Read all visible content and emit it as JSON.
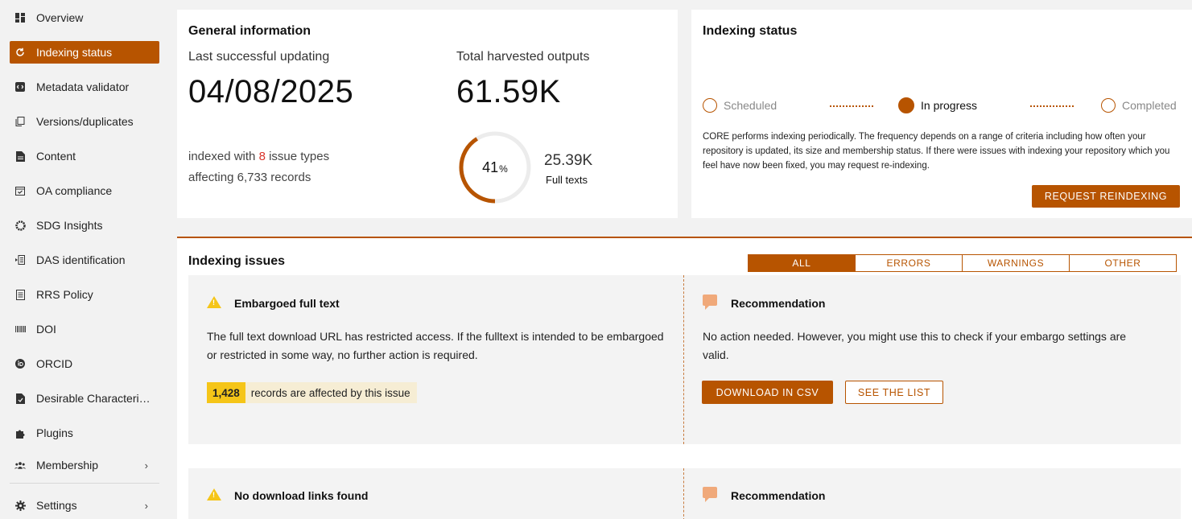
{
  "sidebar": {
    "items": [
      {
        "label": "Overview",
        "icon": "dashboard-icon"
      },
      {
        "label": "Indexing status",
        "icon": "sync-icon",
        "active": true
      },
      {
        "label": "Metadata validator",
        "icon": "code-icon"
      },
      {
        "label": "Versions/duplicates",
        "icon": "copy-icon"
      },
      {
        "label": "Content",
        "icon": "file-icon"
      },
      {
        "label": "OA compliance",
        "icon": "checkbox-icon"
      },
      {
        "label": "SDG Insights",
        "icon": "sdg-wheel-icon"
      },
      {
        "label": "DAS identification",
        "icon": "das-icon"
      },
      {
        "label": "RRS Policy",
        "icon": "policy-icon"
      },
      {
        "label": "DOI",
        "icon": "barcode-icon"
      },
      {
        "label": "ORCID",
        "icon": "orcid-icon"
      },
      {
        "label": "Desirable Characteri…",
        "icon": "document-icon"
      },
      {
        "label": "Plugins",
        "icon": "puzzle-icon"
      },
      {
        "label": "Membership",
        "icon": "members-icon"
      },
      {
        "label": "Settings",
        "icon": "gear-icon"
      }
    ]
  },
  "general": {
    "title": "General information",
    "last_update_label": "Last successful updating",
    "last_update_value": "04/08/2025",
    "total_label": "Total harvested outputs",
    "total_value": "61.59K",
    "issues_prefix": "indexed with",
    "issue_types_count": "8",
    "issues_suffix": "issue types",
    "affecting": "affecting 6,733 records",
    "fulltext_percent": 41,
    "fulltext_percent_label": "41",
    "percent_sign": "%",
    "fulltext_count": "25.39K",
    "fulltext_label": "Full texts"
  },
  "status": {
    "title": "Indexing status",
    "steps": [
      "Scheduled",
      "In progress",
      "Completed"
    ],
    "current_step": "In progress",
    "description": "CORE performs indexing periodically. The frequency depends on a range of criteria including how often your repository is updated, its size and membership status. If there were issues with indexing your repository which you feel have now been fixed, you may request re-indexing.",
    "reindex_button": "REQUEST REINDEXING"
  },
  "issues": {
    "title": "Indexing issues",
    "filters": [
      "ALL",
      "ERRORS",
      "WARNINGS",
      "OTHER"
    ],
    "active_filter": "ALL",
    "list": [
      {
        "title": "Embargoed full text",
        "description": "The full text download URL has restricted access. If the fulltext is intended to be embargoed or restricted in some way, no further action is required.",
        "count": "1,428",
        "count_text": "records are affected by this issue",
        "rec_title": "Recommendation",
        "rec_text": "No action needed. However, you might use this to check if your embargo settings are valid.",
        "download_button": "DOWNLOAD IN CSV",
        "list_button": "SEE THE LIST"
      },
      {
        "title": "No download links found",
        "rec_title": "Recommendation"
      }
    ]
  },
  "colors": {
    "accent": "#b75400",
    "warning": "#f5c518",
    "error_text": "#d9342b"
  }
}
